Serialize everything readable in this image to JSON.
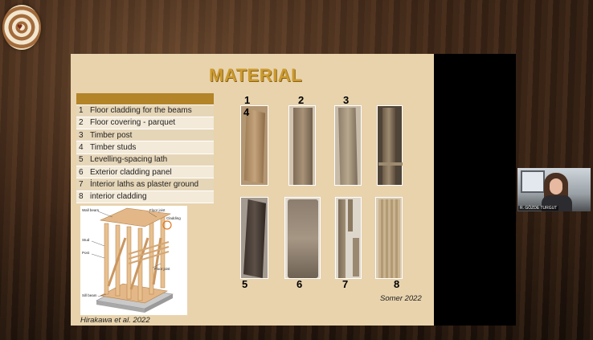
{
  "slide": {
    "title": "MATERIAL",
    "materials": [
      {
        "num": "1",
        "label": "Floor cladding for the beams"
      },
      {
        "num": "2",
        "label": "Floor covering - parquet"
      },
      {
        "num": "3",
        "label": "Timber post"
      },
      {
        "num": "4",
        "label": "Timber studs"
      },
      {
        "num": "5",
        "label": "Levelling-spacing lath"
      },
      {
        "num": "6",
        "label": "Exterior cladding panel"
      },
      {
        "num": "7",
        "label": "İnterior laths as plaster ground"
      },
      {
        "num": "8",
        "label": "interior cladding"
      }
    ],
    "diagram_labels": {
      "wall_beam": "Wall beam",
      "floor_joist_top": "Floor joist",
      "cladding": "Cladding",
      "stud": "Stud",
      "post": "Post",
      "floor_joist_bottom": "Floor joist",
      "sill_beam": "Sill beam"
    },
    "caption_left": "Hirakawa et al. 2022",
    "caption_right": "Somer 2022",
    "photo_numbers": [
      "1",
      "2",
      "3",
      "4",
      "5",
      "6",
      "7",
      "8"
    ]
  },
  "webcam": {
    "name": "R. GÖZDE TURGUT"
  },
  "colors": {
    "slide_bg": "#e8d3ad",
    "title": "#cc9a2e",
    "table_header": "#b38428"
  },
  "icons": {
    "logo": "heart-rings-logo-icon"
  }
}
